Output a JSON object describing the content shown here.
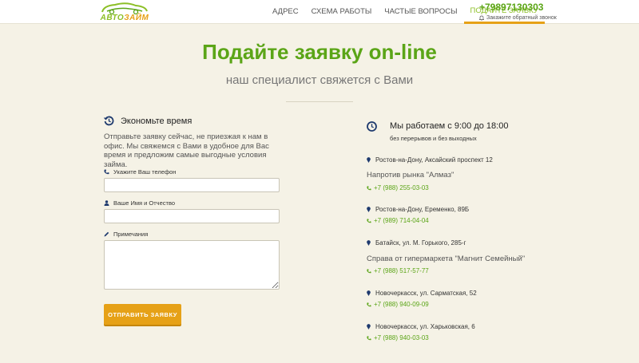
{
  "header": {
    "logo_text_a": "АВТО",
    "logo_text_b": "ЗАЙМ",
    "nav": [
      {
        "label": "Адрес"
      },
      {
        "label": "Схема работы"
      },
      {
        "label": "Частые вопросы"
      },
      {
        "label": "Подайте заявку",
        "active": true
      }
    ],
    "phone": "+79897130303",
    "callback": "Закажите обратный звонок"
  },
  "hero": {
    "title": "Подайте заявку on-line",
    "subtitle": "наш специалист свяжется с Вами"
  },
  "form": {
    "heading": "Экономьте время",
    "description": "Отправьте заявку сейчас, не приезжая к нам в офис. Мы свяжемся с Вами в удобное для Вас время и предложим самые выгодные условия займа.",
    "phone_label": "Укажите Ваш телефон",
    "phone_value": "",
    "name_label": "Ваше Имя и Отчество",
    "name_value": "",
    "notes_label": "Примечания",
    "notes_value": "",
    "submit_label": "Отправить заявку"
  },
  "info": {
    "hours_title": "Мы работаем с 9:00 до 18:00",
    "hours_sub": "без перерывов и без выходных",
    "locations": [
      {
        "address": "Ростов-на-Дону, Аксайский проспект 12",
        "note": "Напротив рынка \"Алмаз\"",
        "phone": "+7 (988) 255-03-03"
      },
      {
        "address": "Ростов-на-Дону, Еременко, 89Б",
        "note": "",
        "phone": "+7 (989) 714-04-04"
      },
      {
        "address": "Батайск, ул. М. Горького, 285-г",
        "note": "Справа от гипермаркета \"Магнит Семейный\"",
        "phone": "+7 (988) 517-57-77"
      },
      {
        "address": "Новочеркасск, ул. Сарматская, 52",
        "note": "",
        "phone": "+7 (988) 940-09-09"
      },
      {
        "address": "Новочеркасск, ул. Харьковская, 6",
        "note": "",
        "phone": "+7 (988) 940-03-03"
      }
    ]
  },
  "colors": {
    "brand_green": "#5ba517",
    "accent_orange": "#e6a117",
    "navy_icon": "#1e3a6e",
    "background": "#f5f2e6"
  },
  "icons": {
    "logo": "car-logo-icon",
    "callback": "bell-icon",
    "form_heading": "clock-rewind-icon",
    "phone_field": "phone-icon",
    "name_field": "user-icon",
    "notes_field": "pencil-icon",
    "hours": "clock-icon",
    "location": "map-pin-icon",
    "location_phone": "phone-icon"
  }
}
